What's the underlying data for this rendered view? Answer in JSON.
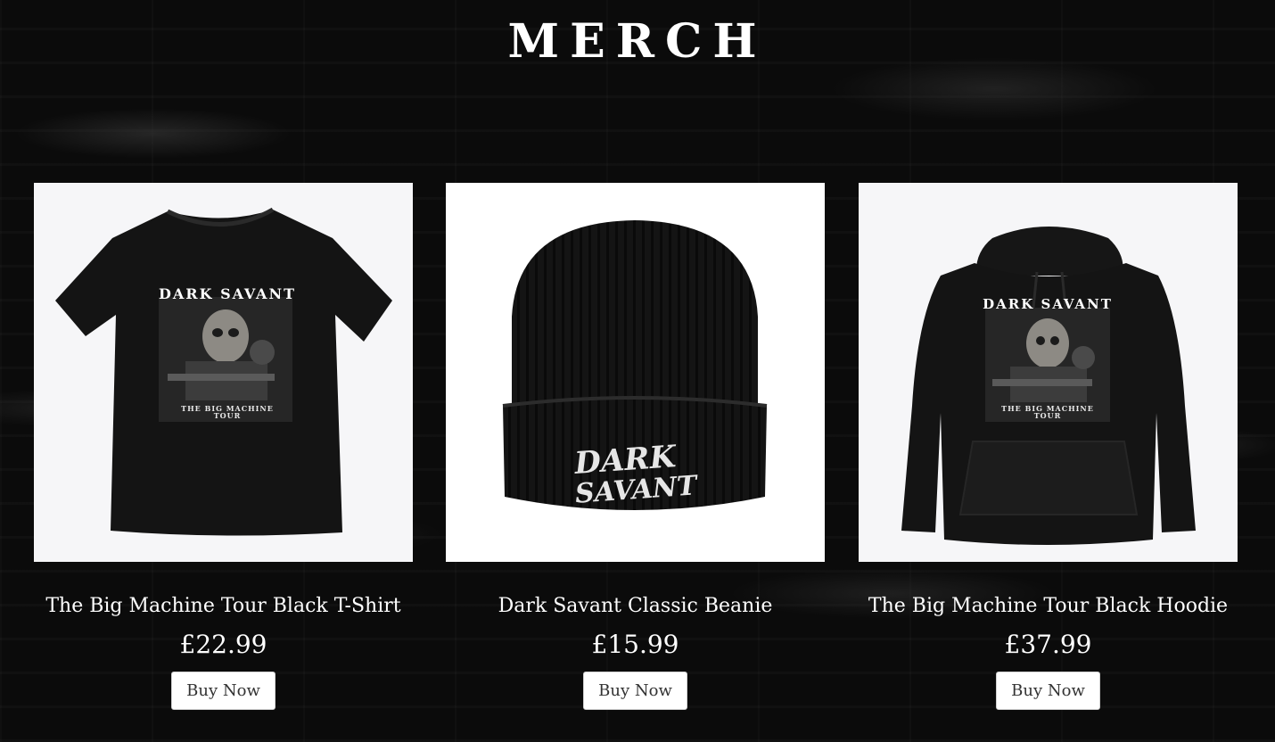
{
  "header": {
    "title": "MERCH"
  },
  "products": [
    {
      "name": "The Big Machine Tour Black T-Shirt",
      "price": "£22.99",
      "button_label": "Buy Now",
      "print_band": "DARK SAVANT",
      "print_tour": "THE BIG MACHINE",
      "print_tour_2": "TOUR"
    },
    {
      "name": "Dark Savant Classic Beanie",
      "price": "£15.99",
      "button_label": "Buy Now",
      "embroidery_line1": "DARK",
      "embroidery_line2": "SAVANT"
    },
    {
      "name": "The Big Machine Tour Black Hoodie",
      "price": "£37.99",
      "button_label": "Buy Now",
      "print_band": "DARK SAVANT",
      "print_tour": "THE BIG MACHINE",
      "print_tour_2": "TOUR"
    }
  ],
  "colors": {
    "background": "#0b0b0b",
    "garment": "#141414",
    "image_background": "#f6f6f8",
    "button_background": "#ffffff",
    "button_text": "#333333"
  }
}
